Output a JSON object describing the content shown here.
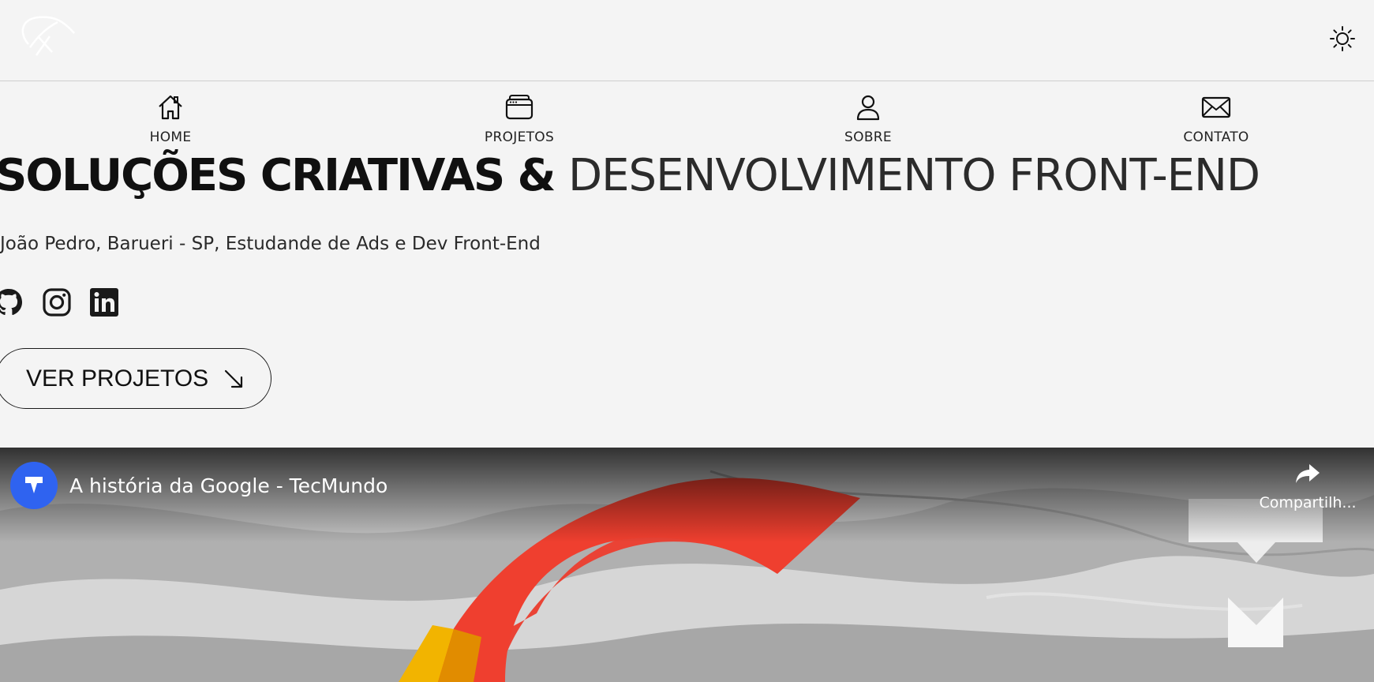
{
  "header": {
    "logo_icon": "signature-logo-icon",
    "theme_toggle_icon": "sun-icon"
  },
  "nav": {
    "items": [
      {
        "label": "HOME",
        "icon": "home-icon"
      },
      {
        "label": "PROJETOS",
        "icon": "browser-windows-icon"
      },
      {
        "label": "SOBRE",
        "icon": "user-icon"
      },
      {
        "label": "CONTATO",
        "icon": "envelope-icon"
      }
    ]
  },
  "hero": {
    "headline_strong": "SOLUÇÕES CRIATIVAS & ",
    "headline_light": "DESENVOLVIMENTO FRONT-END",
    "subtitle": "João Pedro, Barueri - SP, Estudande de Ads e Dev Front-End",
    "socials": [
      {
        "icon": "github-icon"
      },
      {
        "icon": "instagram-icon"
      },
      {
        "icon": "linkedin-icon"
      }
    ],
    "cta_label": "VER PROJETOS",
    "cta_icon": "arrow-down-right-icon"
  },
  "video": {
    "title": "A história da Google - TecMundo",
    "share_label": "Compartilh...",
    "channel_icon": "tecmundo-logo-icon",
    "share_icon": "share-arrow-icon"
  },
  "colors": {
    "background": "#f4f4f4",
    "text": "#151515",
    "channel_blue": "#2f63f0",
    "google_red": "#ea4335"
  }
}
